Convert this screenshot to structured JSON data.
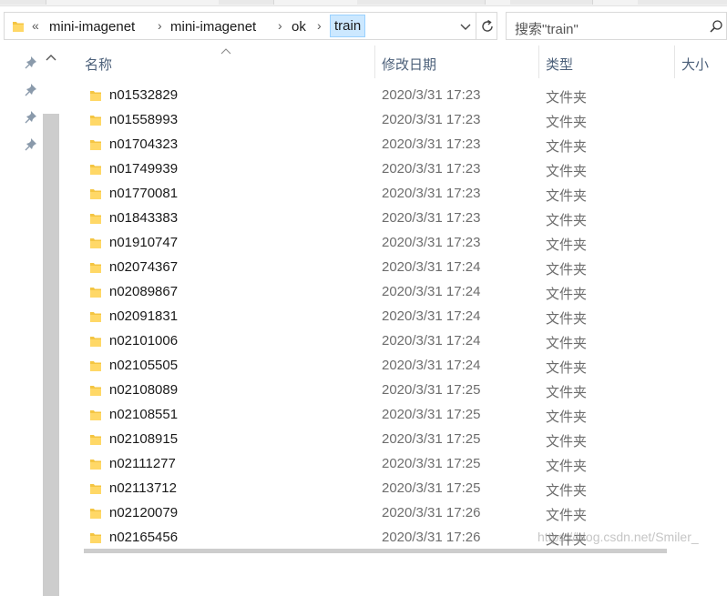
{
  "address_bar": {
    "overflow_glyph": "«",
    "crumbs": [
      "mini-imagenet",
      "mini-imagenet",
      "ok"
    ],
    "current": "train",
    "separator": "›"
  },
  "search": {
    "placeholder": "搜索\"train\""
  },
  "columns": {
    "name": "名称",
    "date": "修改日期",
    "type": "类型",
    "size": "大小"
  },
  "files": [
    {
      "name": "n01532829",
      "date": "2020/3/31 17:23",
      "type": "文件夹"
    },
    {
      "name": "n01558993",
      "date": "2020/3/31 17:23",
      "type": "文件夹"
    },
    {
      "name": "n01704323",
      "date": "2020/3/31 17:23",
      "type": "文件夹"
    },
    {
      "name": "n01749939",
      "date": "2020/3/31 17:23",
      "type": "文件夹"
    },
    {
      "name": "n01770081",
      "date": "2020/3/31 17:23",
      "type": "文件夹"
    },
    {
      "name": "n01843383",
      "date": "2020/3/31 17:23",
      "type": "文件夹"
    },
    {
      "name": "n01910747",
      "date": "2020/3/31 17:23",
      "type": "文件夹"
    },
    {
      "name": "n02074367",
      "date": "2020/3/31 17:24",
      "type": "文件夹"
    },
    {
      "name": "n02089867",
      "date": "2020/3/31 17:24",
      "type": "文件夹"
    },
    {
      "name": "n02091831",
      "date": "2020/3/31 17:24",
      "type": "文件夹"
    },
    {
      "name": "n02101006",
      "date": "2020/3/31 17:24",
      "type": "文件夹"
    },
    {
      "name": "n02105505",
      "date": "2020/3/31 17:24",
      "type": "文件夹"
    },
    {
      "name": "n02108089",
      "date": "2020/3/31 17:25",
      "type": "文件夹"
    },
    {
      "name": "n02108551",
      "date": "2020/3/31 17:25",
      "type": "文件夹"
    },
    {
      "name": "n02108915",
      "date": "2020/3/31 17:25",
      "type": "文件夹"
    },
    {
      "name": "n02111277",
      "date": "2020/3/31 17:25",
      "type": "文件夹"
    },
    {
      "name": "n02113712",
      "date": "2020/3/31 17:25",
      "type": "文件夹"
    },
    {
      "name": "n02120079",
      "date": "2020/3/31 17:26",
      "type": "文件夹"
    },
    {
      "name": "n02165456",
      "date": "2020/3/31 17:26",
      "type": "文件夹"
    }
  ],
  "watermark": "https://blog.csdn.net/Smiler_",
  "icons": {
    "folder": "folder-icon",
    "pin": "pin-icon",
    "refresh": "refresh-icon",
    "search": "search-icon",
    "dropdown": "chevron-down-icon",
    "sort": "sort-up-icon"
  },
  "colors": {
    "folder": "#f4c542",
    "selection": "#cce8ff",
    "header_text": "#4c607a",
    "secondary_text": "#6d6d6d"
  }
}
